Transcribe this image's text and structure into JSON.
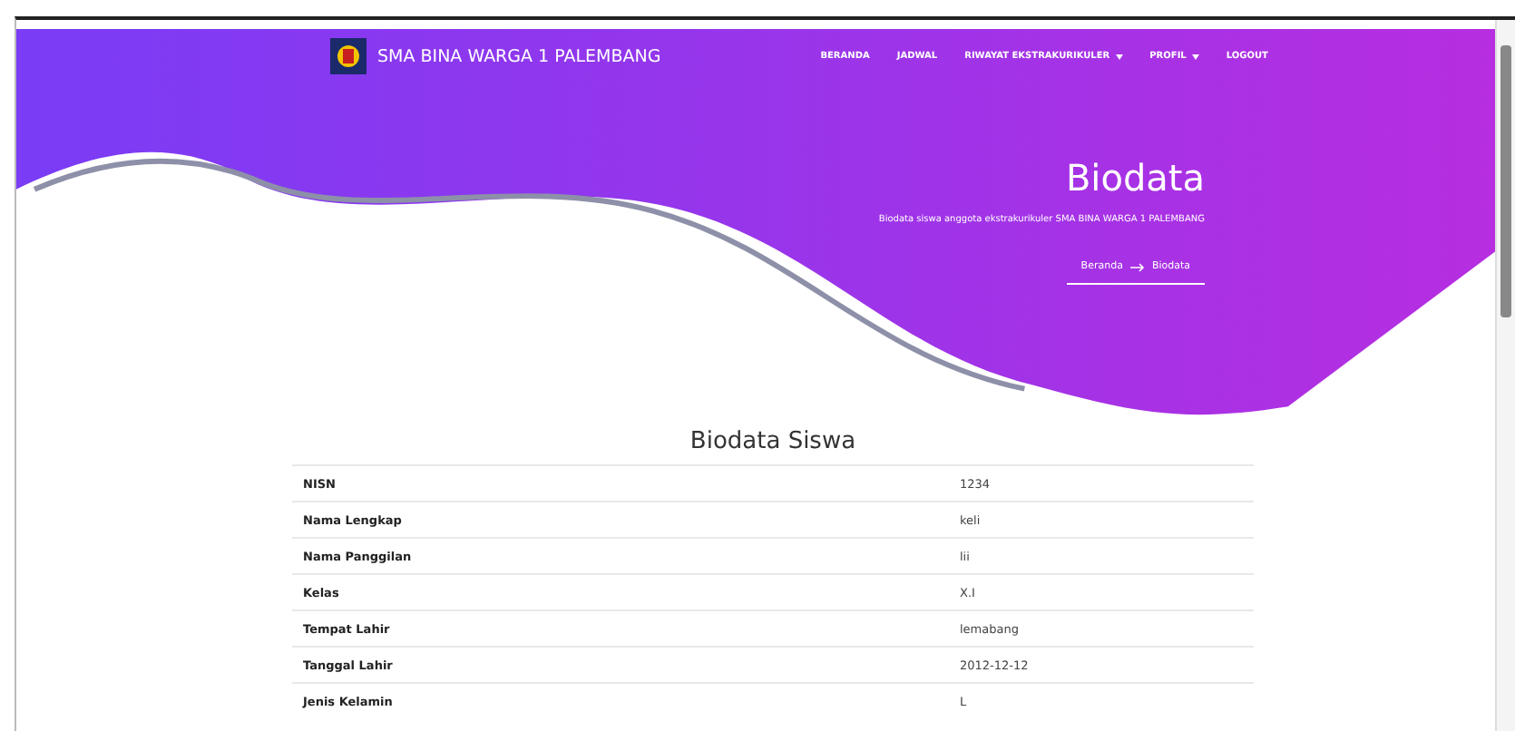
{
  "navbar": {
    "brand": "SMA BINA WARGA 1 PALEMBANG",
    "menu": [
      {
        "label": "BERANDA",
        "dropdown": false
      },
      {
        "label": "JADWAL",
        "dropdown": false
      },
      {
        "label": "RIWAYAT EKSTRAKURIKULER",
        "dropdown": true
      },
      {
        "label": "PROFIL",
        "dropdown": true
      },
      {
        "label": "LOGOUT",
        "dropdown": false
      }
    ]
  },
  "hero": {
    "title": "Biodata",
    "subtitle": "Biodata siswa anggota ekstrakurikuler SMA BINA WARGA 1 PALEMBANG",
    "breadcrumb": [
      "Beranda",
      "Biodata"
    ]
  },
  "section": {
    "title": "Biodata Siswa",
    "rows": [
      {
        "label": "NISN",
        "value": "1234"
      },
      {
        "label": "Nama Lengkap",
        "value": "keli"
      },
      {
        "label": "Nama Panggilan",
        "value": "lii"
      },
      {
        "label": "Kelas",
        "value": "X.I"
      },
      {
        "label": "Tempat Lahir",
        "value": "lemabang"
      },
      {
        "label": "Tanggal Lahir",
        "value": "2012-12-12"
      },
      {
        "label": "Jenis Kelamin",
        "value": "L"
      }
    ]
  }
}
